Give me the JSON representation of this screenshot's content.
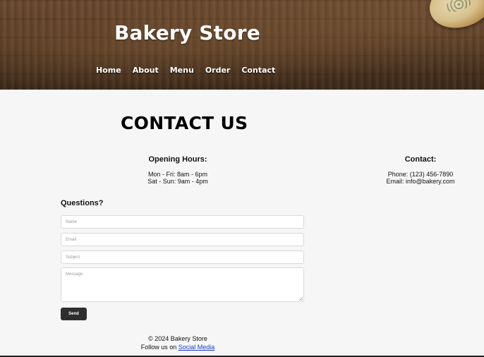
{
  "header": {
    "brand": "Bakery Store",
    "nav": [
      "Home",
      "About",
      "Menu",
      "Order",
      "Contact"
    ]
  },
  "main": {
    "title": "CONTACT US",
    "opening_hours": {
      "heading": "Opening Hours:",
      "lines": [
        "Mon - Fri: 8am - 6pm",
        "Sat - Sun: 9am - 4pm"
      ]
    },
    "contact": {
      "heading": "Contact:",
      "phone": "Phone: (123) 456-7890",
      "email": "Email: info@bakery.com"
    },
    "form": {
      "heading": "Questions?",
      "name_placeholder": "Name",
      "email_placeholder": "Email",
      "subject_placeholder": "Subject",
      "message_placeholder": "Message",
      "send_label": "Send"
    }
  },
  "footer": {
    "copyright": "© 2024 Bakery Store",
    "follow_prefix": "Follow us on ",
    "social_link": "Social Media"
  },
  "colors": {
    "button_bg": "#2e2e2e",
    "link": "#1a3bd6",
    "page_bg": "#f6f6f6"
  }
}
